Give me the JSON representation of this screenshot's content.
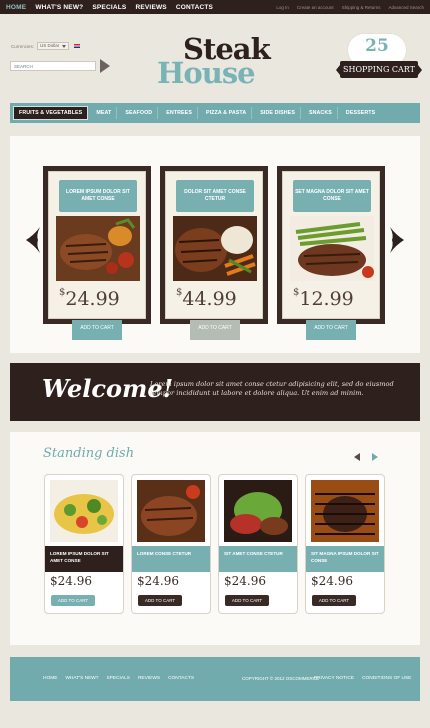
{
  "topnav": {
    "items": [
      "HOME",
      "WHAT'S NEW?",
      "SPECIALS",
      "REVIEWS",
      "CONTACTS"
    ]
  },
  "toplinks": [
    "Log In",
    "Create an account",
    "Shipping & Returns",
    "Advanced Search"
  ],
  "currency": {
    "label": "Currencies:",
    "value": "US Dollar"
  },
  "search": {
    "placeholder": "SEARCH"
  },
  "logo": {
    "line1": "Steak",
    "line2": "House"
  },
  "cart": {
    "count": "25",
    "label": "SHOPPING CART"
  },
  "mainnav": {
    "items": [
      "FRUITS & VEGETABLES",
      "MEAT",
      "SEAFOOD",
      "ENTREES",
      "PIZZA & PASTA",
      "SIDE DISHES",
      "SNACKS",
      "DESSERTS"
    ]
  },
  "featured": [
    {
      "title": "LOREM IPSUM DOLOR SIT AMET CONSE",
      "currency": "$",
      "price": "24.99",
      "button": "ADD TO CART"
    },
    {
      "title": "DOLOR SIT AMET CONSE CTETUR",
      "currency": "$",
      "price": "44.99",
      "button": "ADD TO CART"
    },
    {
      "title": "SET MAGNA DOLOR SIT AMET CONSE",
      "currency": "$",
      "price": "12.99",
      "button": "ADD TO CART"
    }
  ],
  "welcome": {
    "heading": "Welcome!",
    "text": "Lorem ipsum dolor sit amet conse ctetur adipisicing elit, sed do eiusmod tempor incididunt ut labore et dolore aliqua. Ut enim ad minim."
  },
  "standing": {
    "title": "Standing dish",
    "dishes": [
      {
        "name": "LOREM IPSUM DOLOR SIT AMET CONSE",
        "price": "$24.96",
        "button": "ADD TO CART"
      },
      {
        "name": "LOREM CONSE CTETUR",
        "price": "$24.96",
        "button": "ADD TO CART"
      },
      {
        "name": "SIT AMET CONSE CTETUR",
        "price": "$24.96",
        "button": "ADD TO CART"
      },
      {
        "name": "SIT MAGNA IPSUM DOLOR SIT CONSE",
        "price": "$24.96",
        "button": "ADD TO CART"
      }
    ]
  },
  "footer": {
    "links": [
      "HOME",
      "WHAT'S NEW?",
      "SPECIALS",
      "REVIEWS",
      "CONTACTS"
    ],
    "copyright": "COPYRIGHT © 2012 OSCOMMERCE",
    "policies": [
      "PRIVACY NOTICE",
      "CONDITIONS OF USE"
    ]
  },
  "colors": {
    "teal": "#72abad",
    "dark_brown": "#2e211d",
    "background": "#eae7df"
  }
}
